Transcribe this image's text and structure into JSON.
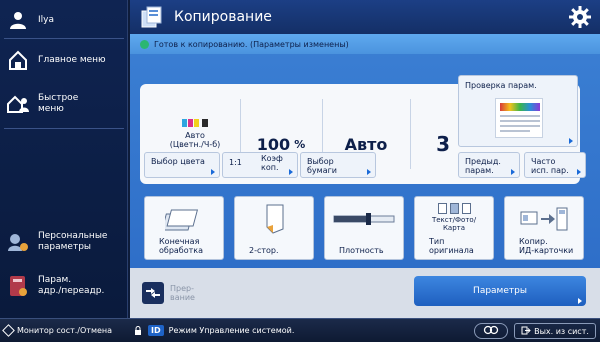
{
  "sidebar": {
    "user": "Ilya",
    "main_menu": "Главное меню",
    "quick_menu_line1": "Быстрое",
    "quick_menu_line2": "меню",
    "personal_line1": "Персональные",
    "personal_line2": "параметры",
    "address_line1": "Парам.",
    "address_line2": "адр./переадр."
  },
  "header": {
    "title": "Копирование"
  },
  "status": {
    "text": "Готов к копированию. (Параметры изменены)"
  },
  "summary": {
    "color_line1": "Авто",
    "color_line2": "(Цветн./Ч-б)",
    "ratio_value": "100",
    "ratio_unit": "%",
    "paper_value": "Авто",
    "copies_value": "3"
  },
  "buttons": {
    "color_select": "Выбор цвета",
    "ratio_1to1": "1:1",
    "coef_line1": "Коэф",
    "coef_line2": "коп.",
    "paper_line1": "Выбор",
    "paper_line2": "бумаги",
    "check_settings": "Проверка парам.",
    "prev_line1": "Предыд.",
    "prev_line2": "парам.",
    "freq_line1": "Часто",
    "freq_line2": "исп. пар."
  },
  "functions": [
    {
      "line1": "Конечная",
      "line2": "обработка"
    },
    {
      "line1": "",
      "line2": "2-стор."
    },
    {
      "line1": "",
      "line2": "Плотность"
    },
    {
      "top_line1": "Текст/Фото/",
      "top_line2": "Карта",
      "line1": "Тип",
      "line2": "оригинала"
    },
    {
      "line1": "Копир.",
      "line2": "ИД-карточки"
    }
  ],
  "bottom": {
    "interrupt_line1": "Прер-",
    "interrupt_line2": "вание",
    "options": "Параметры"
  },
  "footer": {
    "monitor": "Монитор сост./Отмена",
    "id_badge": "ID",
    "mode": "Режим Управление системой.",
    "logout": "Вых. из сист."
  },
  "colors": {
    "accent": "#2c6bc6",
    "sidebar_bg": "#0f2452",
    "status_ok": "#2bb673"
  }
}
